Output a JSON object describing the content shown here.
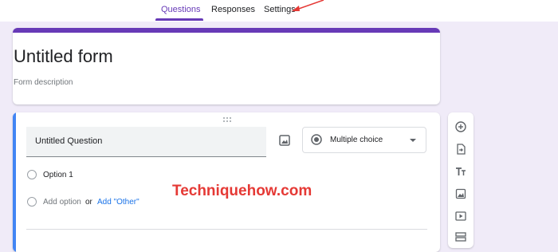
{
  "nav": {
    "tabs": [
      {
        "label": "Questions",
        "active": true
      },
      {
        "label": "Responses",
        "active": false
      },
      {
        "label": "Settings",
        "active": false
      }
    ]
  },
  "form": {
    "title": "Untitled form",
    "description_placeholder": "Form description"
  },
  "question": {
    "title": "Untitled Question",
    "type": "Multiple choice",
    "options": [
      "Option 1"
    ],
    "add_option": "Add option",
    "or_text": "or",
    "add_other": "Add \"Other\""
  },
  "watermark": "Techniquehow.com",
  "toolbar": {
    "icons": [
      "add-question-icon",
      "import-questions-icon",
      "add-title-icon",
      "add-image-icon",
      "add-video-icon",
      "add-section-icon"
    ]
  },
  "colors": {
    "accent": "#673ab7",
    "background": "#f0ebf8",
    "question_band": "#4285f4",
    "link": "#1a73e8",
    "watermark": "#e53935"
  }
}
